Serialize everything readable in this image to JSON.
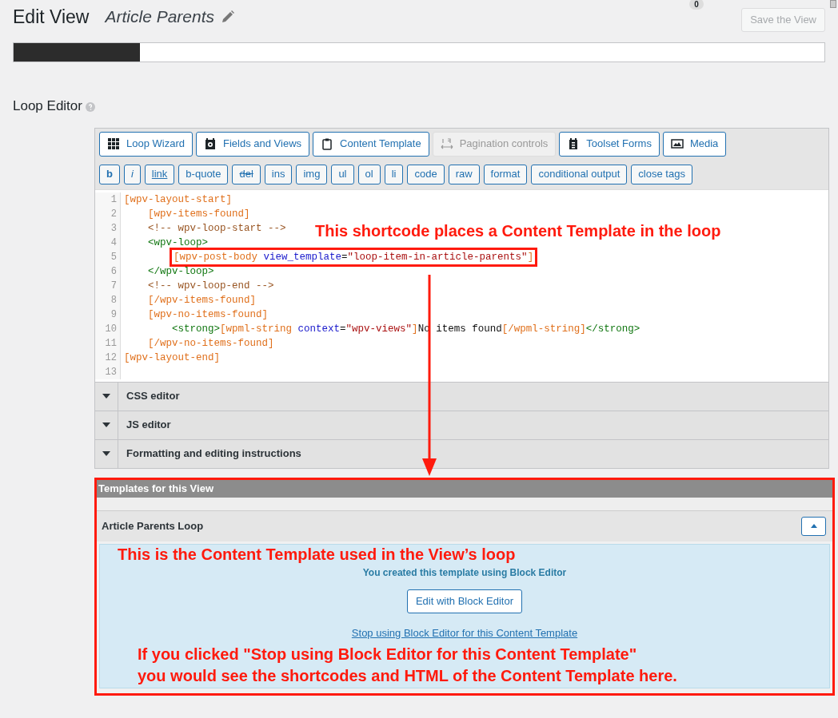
{
  "header": {
    "title": "Edit View",
    "view_name": "Article Parents",
    "badge": "0",
    "save_button": {
      "label": "Save the View",
      "disabled": true
    }
  },
  "progress": {
    "level": 0.156
  },
  "section_title": "Loop Editor",
  "toolbar_main": [
    {
      "label": "Loop Wizard",
      "kind": "grid",
      "disabled": false
    },
    {
      "label": "Fields and Views",
      "kind": "camera",
      "disabled": false
    },
    {
      "label": "Content Template",
      "kind": "clipboard",
      "disabled": false
    },
    {
      "label": "Pagination controls",
      "kind": "pagination",
      "disabled": true
    },
    {
      "label": "Toolset Forms",
      "kind": "forms",
      "disabled": false
    },
    {
      "label": "Media",
      "kind": "image",
      "disabled": false
    }
  ],
  "toolbar_tags": [
    {
      "label": "b",
      "kind": "bold"
    },
    {
      "label": "i",
      "kind": "italic"
    },
    {
      "label": "link",
      "kind": "underline"
    },
    {
      "label": "b-quote",
      "kind": "plain"
    },
    {
      "label": "del",
      "kind": "strike"
    },
    {
      "label": "ins",
      "kind": "plain"
    },
    {
      "label": "img",
      "kind": "plain"
    },
    {
      "label": "ul",
      "kind": "plain"
    },
    {
      "label": "ol",
      "kind": "plain"
    },
    {
      "label": "li",
      "kind": "plain"
    },
    {
      "label": "code",
      "kind": "plain"
    },
    {
      "label": "raw",
      "kind": "plain"
    },
    {
      "label": "format",
      "kind": "plain"
    },
    {
      "label": "conditional output",
      "kind": "plain"
    },
    {
      "label": "close tags",
      "kind": "plain"
    }
  ],
  "code_lines": [
    {
      "number": "1",
      "boxed": false,
      "tokens": [
        {
          "kind": "shortcode",
          "text": "[wpv-layout-start]"
        }
      ]
    },
    {
      "number": "2",
      "boxed": false,
      "tokens": [
        {
          "kind": "shortcode",
          "text": "    [wpv-items-found]"
        }
      ]
    },
    {
      "number": "3",
      "boxed": false,
      "tokens": [
        {
          "kind": "comment",
          "text": "    <!-- wpv-loop-start -->"
        }
      ]
    },
    {
      "number": "4",
      "boxed": false,
      "tokens": [
        {
          "kind": "tag",
          "text": "    <wpv-loop>"
        }
      ]
    },
    {
      "number": "5",
      "boxed": true,
      "tokens": [
        {
          "kind": "shortcode",
          "text": "[wpv-post-body "
        },
        {
          "kind": "attr",
          "text": "view_template"
        },
        {
          "kind": "plain",
          "text": "="
        },
        {
          "kind": "string",
          "text": "\"loop-item-in-article-parents\""
        },
        {
          "kind": "shortcode",
          "text": "]"
        }
      ]
    },
    {
      "number": "6",
      "boxed": false,
      "tokens": [
        {
          "kind": "tag",
          "text": "    </wpv-loop>"
        }
      ]
    },
    {
      "number": "7",
      "boxed": false,
      "tokens": [
        {
          "kind": "comment",
          "text": "    <!-- wpv-loop-end -->"
        }
      ]
    },
    {
      "number": "8",
      "boxed": false,
      "tokens": [
        {
          "kind": "shortcode",
          "text": "    [/wpv-items-found]"
        }
      ]
    },
    {
      "number": "9",
      "boxed": false,
      "tokens": [
        {
          "kind": "shortcode",
          "text": "    [wpv-no-items-found]"
        }
      ]
    },
    {
      "number": "10",
      "boxed": false,
      "tokens": [
        {
          "kind": "tag",
          "text": "        <strong>"
        },
        {
          "kind": "shortcode",
          "text": "[wpml-string "
        },
        {
          "kind": "attr",
          "text": "context"
        },
        {
          "kind": "plain",
          "text": "="
        },
        {
          "kind": "string",
          "text": "\"wpv-views\""
        },
        {
          "kind": "shortcode",
          "text": "]"
        },
        {
          "kind": "plain",
          "text": "No items found"
        },
        {
          "kind": "shortcode",
          "text": "[/wpml-string]"
        },
        {
          "kind": "tag",
          "text": "</strong>"
        }
      ]
    },
    {
      "number": "11",
      "boxed": false,
      "tokens": [
        {
          "kind": "shortcode",
          "text": "    [/wpv-no-items-found]"
        }
      ]
    },
    {
      "number": "12",
      "boxed": false,
      "tokens": [
        {
          "kind": "shortcode",
          "text": "[wpv-layout-end]"
        }
      ]
    },
    {
      "number": "13",
      "boxed": false
    }
  ],
  "code_annotation": "This shortcode places a Content Template in the loop",
  "collapsibles": [
    {
      "label": "CSS editor",
      "expanded": false
    },
    {
      "label": "JS editor",
      "expanded": false
    },
    {
      "label": "Formatting and editing instructions",
      "expanded": false
    }
  ],
  "templates": {
    "title": "Templates for this View",
    "item": {
      "name": "Article Parents Loop",
      "expanded": true
    },
    "annotation_top": "This is the Content Template used in the View’s loop",
    "notice": "You created this template using Block Editor",
    "edit_button": "Edit with Block Editor",
    "stop_link": "Stop using Block Editor for this Content Template",
    "annotation_bottom": [
      "If you clicked \"Stop using Block Editor for this Content Template\"",
      "you would see the shortcodes and HTML of the Content Template here."
    ]
  }
}
